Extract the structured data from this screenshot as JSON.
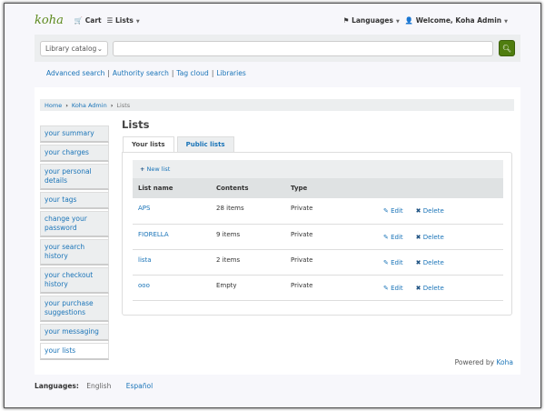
{
  "header": {
    "logo": "koha",
    "cart": "Cart",
    "lists": "Lists",
    "languages": "Languages",
    "welcome": "Welcome, Koha Admin"
  },
  "search": {
    "scope": "Library catalog",
    "value": "",
    "button_icon": "search-icon"
  },
  "links": [
    "Advanced search",
    "Authority search",
    "Tag cloud",
    "Libraries"
  ],
  "breadcrumb": [
    "Home",
    "Koha Admin",
    "Lists"
  ],
  "sidebar": [
    "your summary",
    "your charges",
    "your personal details",
    "your tags",
    "change your password",
    "your search history",
    "your checkout history",
    "your purchase suggestions",
    "your messaging",
    "your lists"
  ],
  "page_title": "Lists",
  "tabs": [
    "Your lists",
    "Public lists"
  ],
  "new_list": "New list",
  "table": {
    "headers": [
      "List name",
      "Contents",
      "Type"
    ],
    "rows": [
      {
        "name": "APS",
        "contents": "28 items",
        "type": "Private"
      },
      {
        "name": "FIORELLA",
        "contents": "9 items",
        "type": "Private"
      },
      {
        "name": "lista",
        "contents": "2 items",
        "type": "Private"
      },
      {
        "name": "ooo",
        "contents": "Empty",
        "type": "Private"
      }
    ],
    "edit": "Edit",
    "delete": "Delete"
  },
  "powered_by": "Powered by",
  "powered_link": "Koha",
  "footer": {
    "label": "Languages:",
    "current": "English",
    "other": "Español"
  }
}
